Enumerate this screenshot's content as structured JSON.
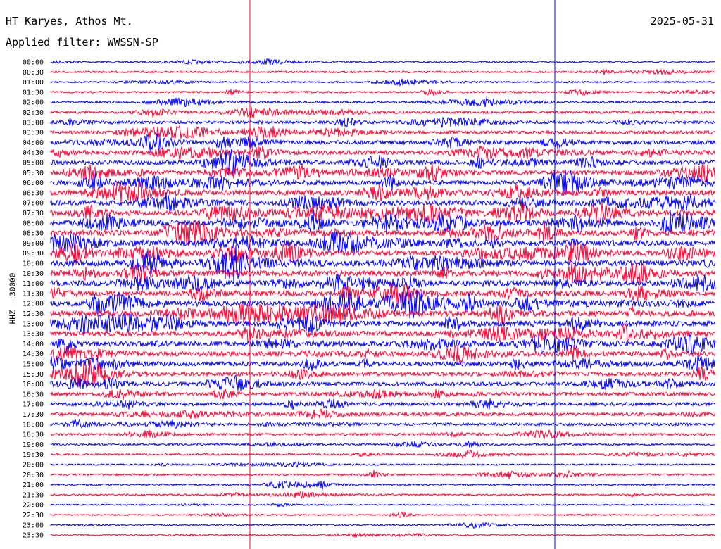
{
  "header": {
    "station": "HT Karyes, Athos Mt.",
    "date": "2025-05-31",
    "filter": "Applied filter: WWSSN-SP"
  },
  "chart_data": {
    "type": "line",
    "title": "HT Karyes, Athos Mt.",
    "ylabel": "HHZ - 30000",
    "xlabel": "",
    "tick_labels": [
      "00:00",
      "00:30",
      "01:00",
      "01:30",
      "02:00",
      "02:30",
      "03:00",
      "03:30",
      "04:00",
      "04:30",
      "05:00",
      "05:30",
      "06:00",
      "06:30",
      "07:00",
      "07:30",
      "08:00",
      "08:30",
      "09:00",
      "09:30",
      "10:00",
      "10:30",
      "11:00",
      "11:30",
      "12:00",
      "12:30",
      "13:00",
      "13:30",
      "14:00",
      "14:30",
      "15:00",
      "15:30",
      "16:00",
      "16:30",
      "17:00",
      "17:30",
      "18:00",
      "18:30",
      "19:00",
      "19:30",
      "20:00",
      "20:30",
      "21:00",
      "21:30",
      "22:00",
      "22:30",
      "23:00",
      "23:30"
    ],
    "trace_minutes": 30,
    "series_colors": [
      "#0000ff",
      "#ff0033"
    ],
    "marker_color": "#ff0033",
    "activity": [
      0.15,
      0.2,
      0.15,
      0.2,
      0.25,
      0.35,
      0.4,
      0.5,
      0.6,
      0.65,
      0.7,
      0.7,
      0.75,
      0.8,
      0.85,
      0.9,
      0.95,
      0.95,
      0.95,
      0.95,
      0.95,
      0.95,
      0.95,
      0.9,
      0.95,
      0.95,
      0.9,
      0.85,
      0.85,
      0.8,
      0.7,
      0.65,
      0.6,
      0.55,
      0.5,
      0.5,
      0.4,
      0.3,
      0.2,
      0.2,
      0.15,
      0.2,
      0.15,
      0.15,
      0.1,
      0.1,
      0.1,
      0.1
    ]
  }
}
